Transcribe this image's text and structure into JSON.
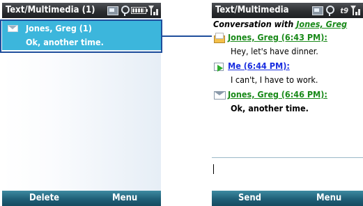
{
  "left_screen": {
    "title": "Text/Multimedia (1)",
    "status_icons": [
      "message-status-icon",
      "notification-icon",
      "battery-icon",
      "signal-icon"
    ],
    "message_row": {
      "sender": "Jones, Greg (1)",
      "preview": "Ok, another time.",
      "icon": "envelope-icon"
    },
    "softkeys": {
      "left": "Delete",
      "right": "Menu"
    }
  },
  "right_screen": {
    "title": "Text/Multimedia",
    "status_icons": [
      "message-status-icon",
      "notification-icon",
      "network-indicator",
      "signal-icon"
    ],
    "network_label": "t9",
    "conversation_label": "Conversation with",
    "contact": "Jones, Greg",
    "messages": [
      {
        "header": "Jones, Greg (6:43 PM):",
        "text": "Hey, let's have dinner.",
        "direction": "incoming",
        "icon": "open-envelope-icon"
      },
      {
        "header": "Me (6:44 PM):",
        "text": "I can't, I have to work.",
        "direction": "outgoing",
        "icon": "sent-message-icon"
      },
      {
        "header": "Jones, Greg (6:46 PM):",
        "text": "Ok, another time.",
        "direction": "incoming",
        "icon": "envelope-icon"
      }
    ],
    "compose_value": "",
    "softkeys": {
      "left": "Send",
      "right": "Menu"
    }
  },
  "colors": {
    "title_bar": "#2c2e31",
    "softkey_bar": "#1f5f77",
    "selection": "#3cb6dc",
    "highlight_box": "#1f4e9c",
    "incoming_link": "#1a8a1a",
    "outgoing_link": "#1a2ee0"
  }
}
